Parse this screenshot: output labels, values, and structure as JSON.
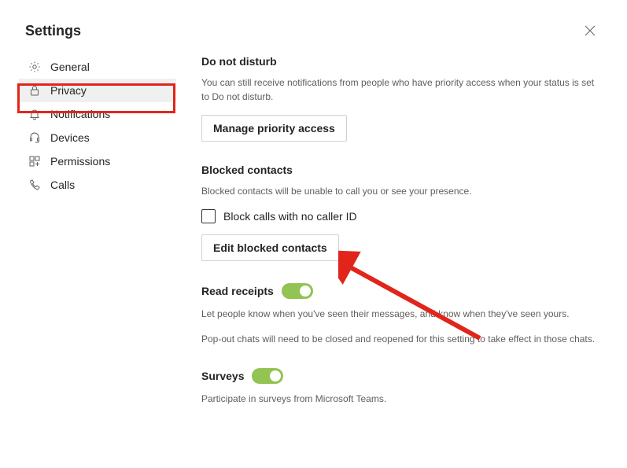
{
  "header": {
    "title": "Settings"
  },
  "sidebar": {
    "items": [
      {
        "label": "General"
      },
      {
        "label": "Privacy"
      },
      {
        "label": "Notifications"
      },
      {
        "label": "Devices"
      },
      {
        "label": "Permissions"
      },
      {
        "label": "Calls"
      }
    ]
  },
  "sections": {
    "dnd": {
      "title": "Do not disturb",
      "desc": "You can still receive notifications from people who have priority access when your status is set to Do not disturb.",
      "button": "Manage priority access"
    },
    "blocked": {
      "title": "Blocked contacts",
      "desc": "Blocked contacts will be unable to call you or see your presence.",
      "checkbox_label": "Block calls with no caller ID",
      "button": "Edit blocked contacts"
    },
    "read": {
      "title": "Read receipts",
      "desc": "Let people know when you've seen their messages, and know when they've seen yours.",
      "desc2": "Pop-out chats will need to be closed and reopened for this setting to take effect in those chats."
    },
    "surveys": {
      "title": "Surveys",
      "desc": "Participate in surveys from Microsoft Teams."
    }
  }
}
